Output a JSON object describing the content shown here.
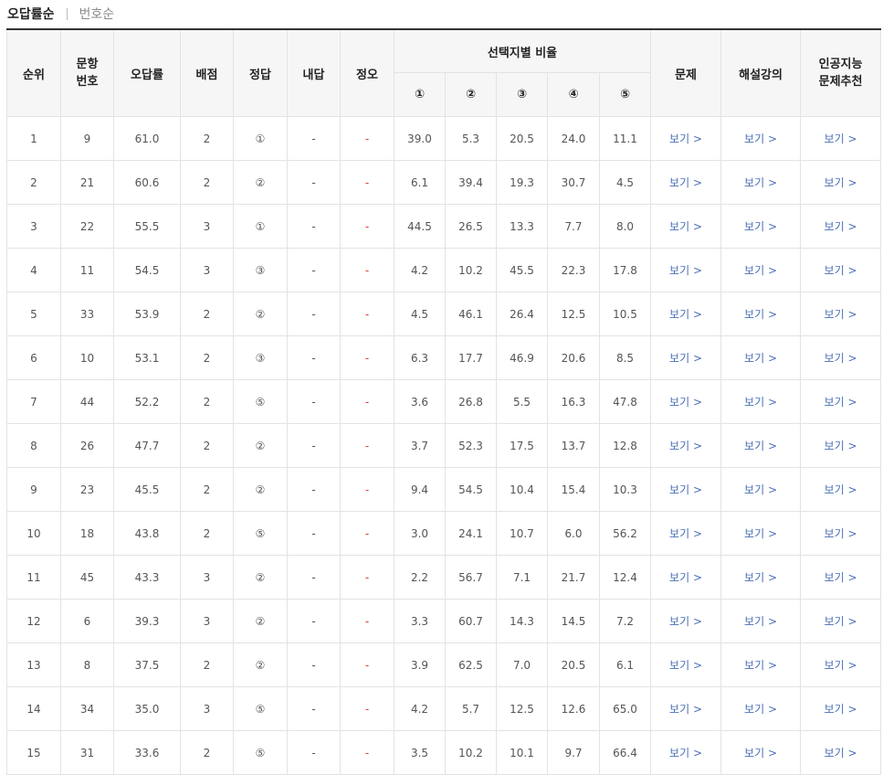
{
  "sort": {
    "active": "오답률순",
    "inactive": "번호순"
  },
  "headers": {
    "rank": "순위",
    "qnum_line1": "문항",
    "qnum_line2": "번호",
    "wrong_rate": "오답률",
    "points": "배점",
    "answer": "정답",
    "my_answer": "내답",
    "correct_wrong": "정오",
    "choice_ratio": "선택지별 비율",
    "choices": [
      "①",
      "②",
      "③",
      "④",
      "⑤"
    ],
    "problem": "문제",
    "lecture": "해설강의",
    "ai_line1": "인공지능",
    "ai_line2": "문제추천"
  },
  "link_label": "보기 >",
  "rows": [
    {
      "rank": "1",
      "qnum": "9",
      "rate": "61.0",
      "points": "2",
      "answer": "①",
      "mine": "-",
      "ox": "-",
      "c1": "39.0",
      "c2": "5.3",
      "c3": "20.5",
      "c4": "24.0",
      "c5": "11.1"
    },
    {
      "rank": "2",
      "qnum": "21",
      "rate": "60.6",
      "points": "2",
      "answer": "②",
      "mine": "-",
      "ox": "-",
      "c1": "6.1",
      "c2": "39.4",
      "c3": "19.3",
      "c4": "30.7",
      "c5": "4.5"
    },
    {
      "rank": "3",
      "qnum": "22",
      "rate": "55.5",
      "points": "3",
      "answer": "①",
      "mine": "-",
      "ox": "-",
      "c1": "44.5",
      "c2": "26.5",
      "c3": "13.3",
      "c4": "7.7",
      "c5": "8.0"
    },
    {
      "rank": "4",
      "qnum": "11",
      "rate": "54.5",
      "points": "3",
      "answer": "③",
      "mine": "-",
      "ox": "-",
      "c1": "4.2",
      "c2": "10.2",
      "c3": "45.5",
      "c4": "22.3",
      "c5": "17.8"
    },
    {
      "rank": "5",
      "qnum": "33",
      "rate": "53.9",
      "points": "2",
      "answer": "②",
      "mine": "-",
      "ox": "-",
      "c1": "4.5",
      "c2": "46.1",
      "c3": "26.4",
      "c4": "12.5",
      "c5": "10.5"
    },
    {
      "rank": "6",
      "qnum": "10",
      "rate": "53.1",
      "points": "2",
      "answer": "③",
      "mine": "-",
      "ox": "-",
      "c1": "6.3",
      "c2": "17.7",
      "c3": "46.9",
      "c4": "20.6",
      "c5": "8.5"
    },
    {
      "rank": "7",
      "qnum": "44",
      "rate": "52.2",
      "points": "2",
      "answer": "⑤",
      "mine": "-",
      "ox": "-",
      "c1": "3.6",
      "c2": "26.8",
      "c3": "5.5",
      "c4": "16.3",
      "c5": "47.8"
    },
    {
      "rank": "8",
      "qnum": "26",
      "rate": "47.7",
      "points": "2",
      "answer": "②",
      "mine": "-",
      "ox": "-",
      "c1": "3.7",
      "c2": "52.3",
      "c3": "17.5",
      "c4": "13.7",
      "c5": "12.8"
    },
    {
      "rank": "9",
      "qnum": "23",
      "rate": "45.5",
      "points": "2",
      "answer": "②",
      "mine": "-",
      "ox": "-",
      "c1": "9.4",
      "c2": "54.5",
      "c3": "10.4",
      "c4": "15.4",
      "c5": "10.3"
    },
    {
      "rank": "10",
      "qnum": "18",
      "rate": "43.8",
      "points": "2",
      "answer": "⑤",
      "mine": "-",
      "ox": "-",
      "c1": "3.0",
      "c2": "24.1",
      "c3": "10.7",
      "c4": "6.0",
      "c5": "56.2"
    },
    {
      "rank": "11",
      "qnum": "45",
      "rate": "43.3",
      "points": "3",
      "answer": "②",
      "mine": "-",
      "ox": "-",
      "c1": "2.2",
      "c2": "56.7",
      "c3": "7.1",
      "c4": "21.7",
      "c5": "12.4"
    },
    {
      "rank": "12",
      "qnum": "6",
      "rate": "39.3",
      "points": "3",
      "answer": "②",
      "mine": "-",
      "ox": "-",
      "c1": "3.3",
      "c2": "60.7",
      "c3": "14.3",
      "c4": "14.5",
      "c5": "7.2"
    },
    {
      "rank": "13",
      "qnum": "8",
      "rate": "37.5",
      "points": "2",
      "answer": "②",
      "mine": "-",
      "ox": "-",
      "c1": "3.9",
      "c2": "62.5",
      "c3": "7.0",
      "c4": "20.5",
      "c5": "6.1"
    },
    {
      "rank": "14",
      "qnum": "34",
      "rate": "35.0",
      "points": "3",
      "answer": "⑤",
      "mine": "-",
      "ox": "-",
      "c1": "4.2",
      "c2": "5.7",
      "c3": "12.5",
      "c4": "12.6",
      "c5": "65.0"
    },
    {
      "rank": "15",
      "qnum": "31",
      "rate": "33.6",
      "points": "2",
      "answer": "⑤",
      "mine": "-",
      "ox": "-",
      "c1": "3.5",
      "c2": "10.2",
      "c3": "10.1",
      "c4": "9.7",
      "c5": "66.4"
    }
  ]
}
